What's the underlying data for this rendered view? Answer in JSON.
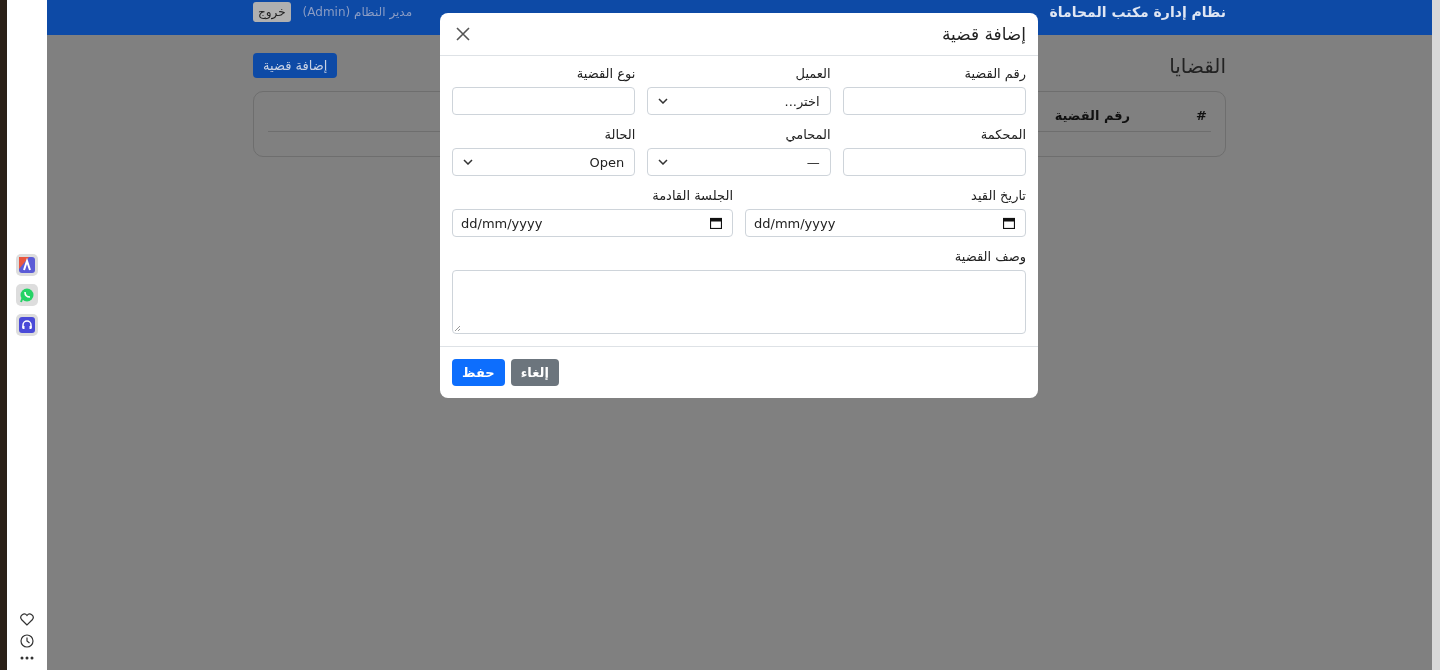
{
  "navbar": {
    "brand": "نظام إدارة مكتب المحاماة",
    "user": "مدير النظام (Admin)",
    "logout": "خروج"
  },
  "page": {
    "title": "القضايا",
    "add_button": "إضافة قضية",
    "table": {
      "columns": [
        "#",
        "رقم القضية"
      ]
    }
  },
  "modal": {
    "title": "إضافة قضية",
    "sections": [
      {
        "fields": [
          {
            "label": "رقم القضية",
            "kind": "text"
          },
          {
            "label": "العميل",
            "kind": "select",
            "value": "اختر..."
          },
          {
            "label": "نوع القضية",
            "kind": "text"
          }
        ]
      },
      {
        "fields": [
          {
            "label": "المحكمة",
            "kind": "text"
          },
          {
            "label": "المحامي",
            "kind": "select",
            "value": "—"
          },
          {
            "label": "الحالة",
            "kind": "select",
            "value": "Open"
          }
        ]
      },
      {
        "fields": [
          {
            "label": "تاريخ القيد",
            "kind": "date",
            "placeholder": "dd/mm/yyyy"
          },
          {
            "label": "الجلسة القادمة",
            "kind": "date",
            "placeholder": "dd/mm/yyyy"
          }
        ]
      },
      {
        "fields": [
          {
            "label": "وصف القضية",
            "kind": "textarea"
          }
        ]
      }
    ],
    "buttons": [
      {
        "label": "إلغاء",
        "kind": "secondary"
      },
      {
        "label": "حفظ",
        "kind": "primary"
      }
    ]
  }
}
